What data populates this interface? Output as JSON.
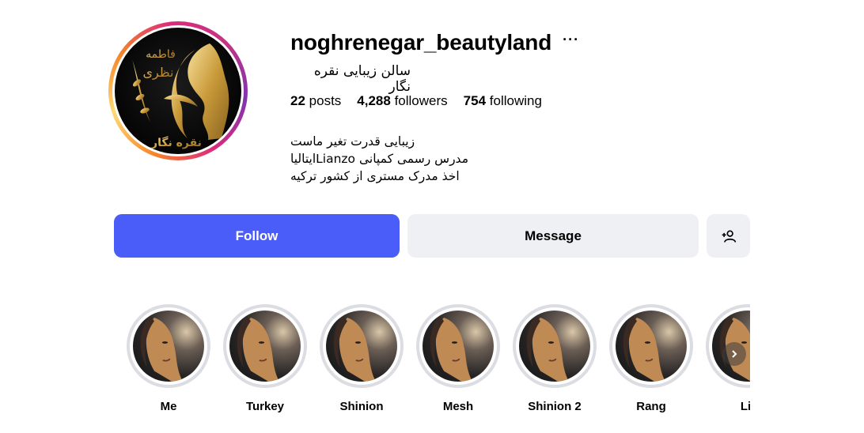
{
  "profile": {
    "username": "noghrenegar_beautyland",
    "more_icon": "more-horizontal-icon",
    "full_name": "سالن زیبایی نقره نگار",
    "stats": {
      "posts_count": "22",
      "posts_label": "posts",
      "followers_count": "4,288",
      "followers_label": "followers",
      "following_count": "754",
      "following_label": "following"
    },
    "bio": [
      "زیبایی قدرت تغیر ماست",
      "مدرس رسمی کمپانی Lianzoایتالیا",
      "اخذ مدرک مستری از کشور ترکیه"
    ],
    "avatar_text": {
      "line1": "فاطمه",
      "line2": "نظری",
      "line3": "نقره نگار"
    }
  },
  "actions": {
    "follow_label": "Follow",
    "message_label": "Message",
    "suggest_icon": "add-person-icon"
  },
  "colors": {
    "follow_bg": "#4a5df9",
    "secondary_bg": "#eff0f4",
    "gold": "#d4a640"
  },
  "highlights": [
    {
      "label": "Me"
    },
    {
      "label": "Turkey"
    },
    {
      "label": "Shinion"
    },
    {
      "label": "Mesh"
    },
    {
      "label": "Shinion 2"
    },
    {
      "label": "Rang"
    },
    {
      "label": "Lif"
    }
  ]
}
